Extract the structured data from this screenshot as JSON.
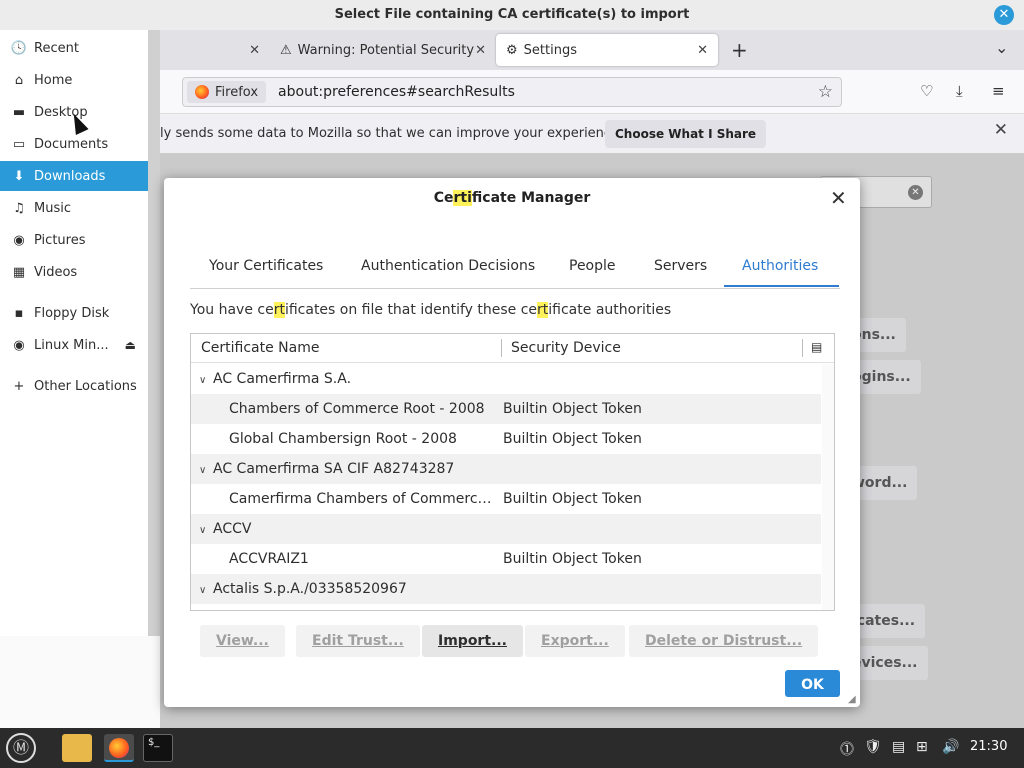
{
  "file_chooser": {
    "title": "Select File containing CA certificate(s) to import",
    "close_glyph": "✕",
    "sidebar": [
      {
        "label": "Recent",
        "icon": "clock-icon",
        "glyph": "🕓"
      },
      {
        "label": "Home",
        "icon": "home-icon",
        "glyph": "⌂"
      },
      {
        "label": "Desktop",
        "icon": "desktop-icon",
        "glyph": "▬"
      },
      {
        "label": "Documents",
        "icon": "document-icon",
        "glyph": "▭"
      },
      {
        "label": "Downloads",
        "icon": "download-icon",
        "glyph": "⬇",
        "active": true
      },
      {
        "label": "Music",
        "icon": "music-icon",
        "glyph": "♫"
      },
      {
        "label": "Pictures",
        "icon": "camera-icon",
        "glyph": "◉"
      },
      {
        "label": "Videos",
        "icon": "film-icon",
        "glyph": "▦"
      },
      {
        "label": "Floppy Disk",
        "icon": "floppy-icon",
        "glyph": "▪"
      },
      {
        "label": "Linux Min...",
        "icon": "disc-icon",
        "glyph": "◉",
        "eject": "⏏"
      },
      {
        "label": "Other Locations",
        "icon": "plus-icon",
        "glyph": "+"
      }
    ]
  },
  "firefox": {
    "tabs": [
      {
        "label": "",
        "close": "✕"
      },
      {
        "label": "Warning: Potential Security",
        "icon_glyph": "⚠",
        "close": "✕"
      },
      {
        "label": "Settings",
        "icon_glyph": "⚙",
        "close": "✕",
        "active": true
      }
    ],
    "new_tab_glyph": "+",
    "list_all_tabs_glyph": "⌄",
    "identity_label": "Firefox",
    "url": "about:preferences#searchResults",
    "bookmark_glyph": "☆",
    "toolbar_glyphs": {
      "pocket": "♡",
      "downloads": "⤓",
      "menu": "≡"
    },
    "notification": {
      "text": "ly sends some data to Mozilla so that we can improve your experience.",
      "button": "Choose What I Share",
      "close": "✕"
    },
    "background_buttons": [
      "ons...",
      "ogins...",
      "word...",
      "icates...",
      "evices..."
    ]
  },
  "dialog": {
    "title_prefix": "Ce",
    "title_highlight": "rti",
    "title_suffix": "ficate Manager",
    "close_glyph": "✕",
    "tabs": [
      "Your Certificates",
      "Authentication Decisions",
      "People",
      "Servers",
      "Authorities"
    ],
    "selected_tab": "Authorities",
    "intro": {
      "p1": "You have ce",
      "h1": "rt",
      "p2": "ificates on file that identify these ce",
      "h2": "rt",
      "p3": "ificate authorities"
    },
    "columns": {
      "name": "Certificate Name",
      "device": "Security Device",
      "picker_glyph": "▤"
    },
    "rows": [
      {
        "type": "group",
        "name": "AC Camerfirma S.A.",
        "twisty": "∨"
      },
      {
        "type": "item",
        "name": "Chambers of Commerce Root - 2008",
        "device": "Builtin Object Token"
      },
      {
        "type": "item",
        "name": "Global Chambersign Root - 2008",
        "device": "Builtin Object Token"
      },
      {
        "type": "group",
        "name": "AC Camerfirma SA CIF A82743287",
        "twisty": "∨"
      },
      {
        "type": "item",
        "name": "Camerfirma Chambers of Commerce Root",
        "device": "Builtin Object Token"
      },
      {
        "type": "group",
        "name": "ACCV",
        "twisty": "∨"
      },
      {
        "type": "item",
        "name": "ACCVRAIZ1",
        "device": "Builtin Object Token"
      },
      {
        "type": "group",
        "name": "Actalis S.p.A./03358520967",
        "twisty": "∨"
      }
    ],
    "buttons": {
      "view": "View...",
      "edit_trust": "Edit Trust...",
      "import": "Import...",
      "export": "Export...",
      "delete": "Delete or Distrust..."
    },
    "ok": "OK"
  },
  "taskbar": {
    "menu_glyph": "Ⓜ",
    "terminal_glyph": "$_",
    "tray_glyphs": [
      "⓵",
      "🛡",
      "▤",
      "⊞",
      "🔊"
    ],
    "clock": "21:30"
  }
}
